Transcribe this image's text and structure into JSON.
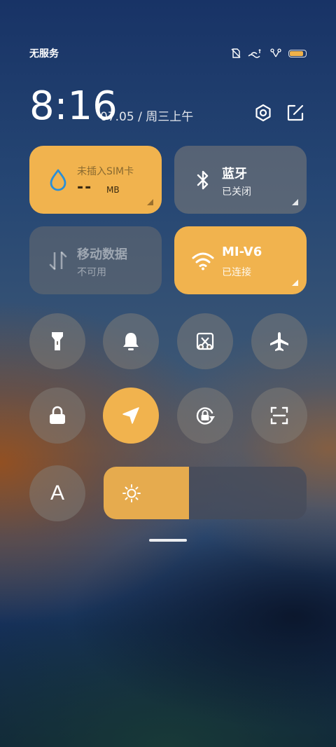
{
  "status_bar": {
    "carrier": "无服务",
    "icons": [
      "no-sim-icon",
      "wifi-calling-icon",
      "cellular-signal-icon",
      "battery-icon"
    ],
    "battery_level": 0.85,
    "battery_color": "#f0b24a"
  },
  "header": {
    "time": "8:16",
    "date": "07.05 / 周三上午",
    "actions": [
      "settings-icon",
      "edit-icon"
    ]
  },
  "tiles": {
    "data_usage": {
      "title": "未插入SIM卡",
      "value": "--",
      "unit": "MB",
      "icon": "water-drop-icon",
      "state": "on"
    },
    "bluetooth": {
      "title": "蓝牙",
      "status": "已关闭",
      "icon": "bluetooth-icon",
      "state": "off"
    },
    "mobile_data": {
      "title": "移动数据",
      "status": "不可用",
      "icon": "data-arrows-icon",
      "state": "disabled"
    },
    "wifi": {
      "title": "MI-V6",
      "status": "已连接",
      "icon": "wifi-icon",
      "state": "on"
    }
  },
  "toggles": [
    {
      "icon": "flashlight-icon",
      "state": "off"
    },
    {
      "icon": "bell-icon",
      "state": "off"
    },
    {
      "icon": "screenshot-icon",
      "state": "off"
    },
    {
      "icon": "airplane-icon",
      "state": "off"
    },
    {
      "icon": "lock-icon",
      "state": "off"
    },
    {
      "icon": "location-icon",
      "state": "on"
    },
    {
      "icon": "rotation-lock-icon",
      "state": "off"
    },
    {
      "icon": "scan-icon",
      "state": "off"
    }
  ],
  "font_toggle": {
    "letter": "A"
  },
  "brightness": {
    "level": 0.42,
    "icon": "sun-icon"
  },
  "colors": {
    "accent": "#f1b34e",
    "tile_off": "#8a857f"
  }
}
